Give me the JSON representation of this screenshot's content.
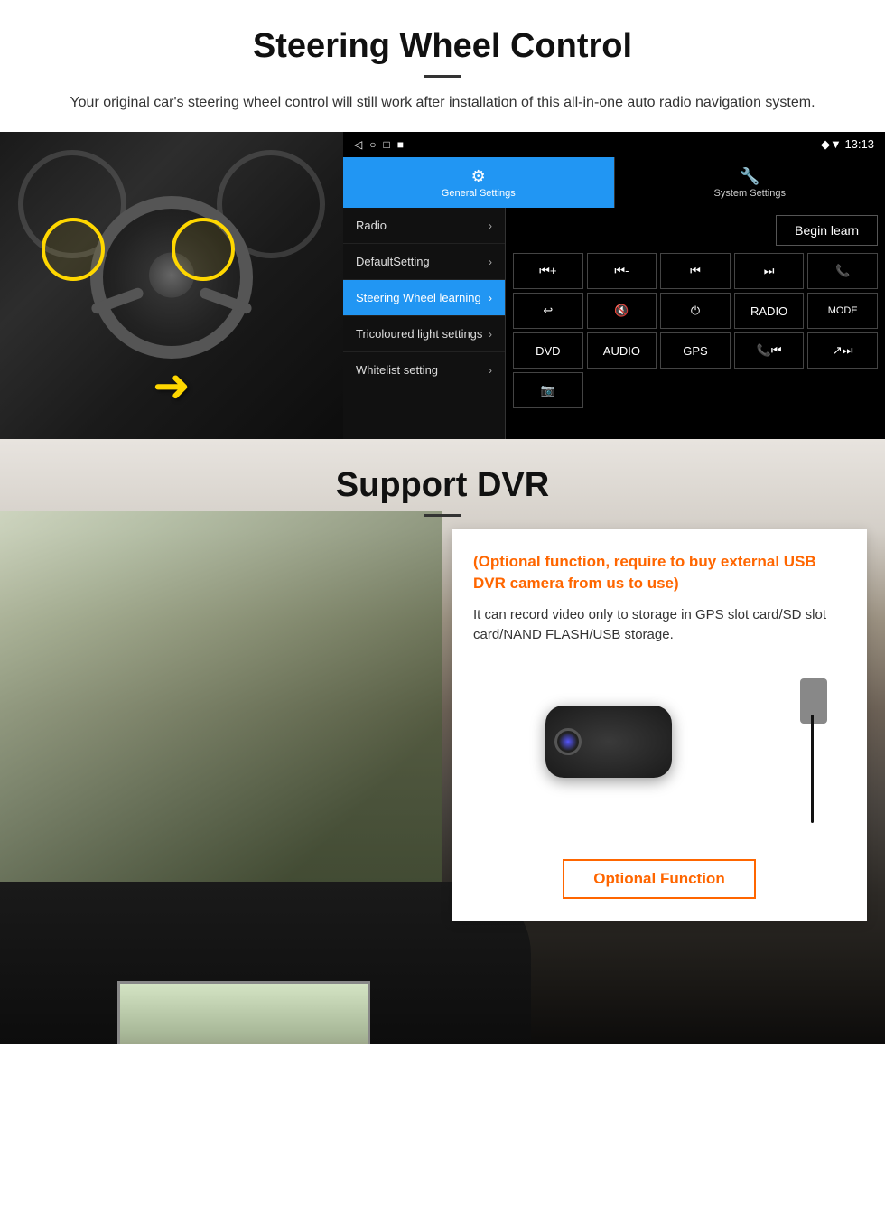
{
  "page": {
    "section1": {
      "title": "Steering Wheel Control",
      "subtitle": "Your original car's steering wheel control will still work after installation of this all-in-one auto radio navigation system.",
      "android_ui": {
        "status_bar": {
          "icons": "◁  ○  □  ■",
          "time": "13:13",
          "signal": "▼"
        },
        "tabs": [
          {
            "label": "General Settings",
            "active": true,
            "icon": "⚙"
          },
          {
            "label": "System Settings",
            "active": false,
            "icon": "🔧"
          }
        ],
        "menu_items": [
          {
            "label": "Radio",
            "active": false
          },
          {
            "label": "DefaultSetting",
            "active": false
          },
          {
            "label": "Steering Wheel learning",
            "active": true
          },
          {
            "label": "Tricoloured light settings",
            "active": false
          },
          {
            "label": "Whitelist setting",
            "active": false
          }
        ],
        "begin_learn_label": "Begin learn",
        "control_buttons_row1": [
          "⏮+",
          "⏮-",
          "⏮|",
          "|▶▶",
          "📞"
        ],
        "control_buttons_row2": [
          "↩",
          "🔇x",
          "⏻",
          "RADIO",
          "MODE"
        ],
        "control_buttons_row3": [
          "DVD",
          "AUDIO",
          "GPS",
          "📞⏮|",
          "↗⏭"
        ]
      }
    },
    "section2": {
      "title": "Support DVR",
      "optional_text": "(Optional function, require to buy external USB DVR camera from us to use)",
      "body_text": "It can record video only to storage in GPS slot card/SD slot card/NAND FLASH/USB storage.",
      "optional_btn_label": "Optional Function"
    }
  }
}
